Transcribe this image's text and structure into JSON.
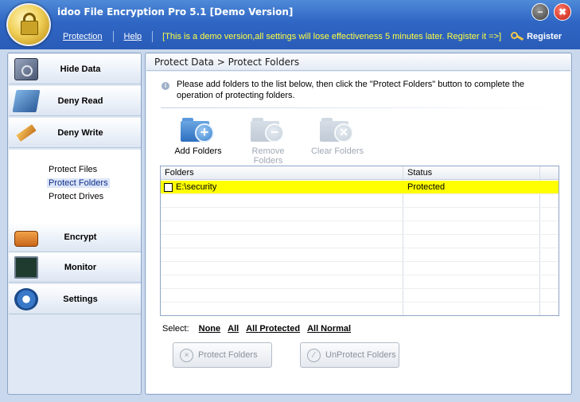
{
  "window": {
    "title": "idoo File Encryption Pro 5.1 [Demo Version]",
    "minimize_glyph": "−",
    "close_glyph": "✖"
  },
  "menu": {
    "items": [
      {
        "label": "Protection"
      },
      {
        "label": "Help"
      }
    ],
    "demo_notice": "[This is a demo version,all settings will lose effectiveness 5 minutes later. Register it =>]",
    "register_label": "Register"
  },
  "sidebar": {
    "nav": [
      {
        "label": "Hide Data",
        "icon": "safe-icon"
      },
      {
        "label": "Deny Read",
        "icon": "book-icon"
      },
      {
        "label": "Deny Write",
        "icon": "pen-icon"
      },
      {
        "label": "Encrypt",
        "icon": "lock-icon"
      },
      {
        "label": "Monitor",
        "icon": "monitor-icon"
      },
      {
        "label": "Settings",
        "icon": "gear-icon"
      }
    ],
    "sub_items": [
      {
        "label": "Protect Files",
        "active": false
      },
      {
        "label": "Protect Folders",
        "active": true
      },
      {
        "label": "Protect Drives",
        "active": false
      }
    ]
  },
  "main": {
    "breadcrumb": "Protect Data > Protect Folders",
    "info_text": "Please add folders to the list below, then click the \"Protect Folders\" button to complete the operation of protecting folders.",
    "info_glyph": "i",
    "toolbar": [
      {
        "label": "Add Folders",
        "enabled": true,
        "glyph": "+"
      },
      {
        "label": "Remove Folders",
        "enabled": false,
        "glyph": "−"
      },
      {
        "label": "Clear Folders",
        "enabled": false,
        "glyph": "×"
      }
    ],
    "table": {
      "columns": [
        "Folders",
        "Status"
      ],
      "rows": [
        {
          "folder": "E:\\security",
          "status": "Protected",
          "checked": false,
          "highlighted": true
        }
      ]
    },
    "select": {
      "label": "Select:",
      "options": [
        "None",
        "All",
        "All Protected",
        "All Normal"
      ]
    },
    "actions": [
      {
        "label": "Protect Folders",
        "glyph": "×"
      },
      {
        "label": "UnProtect Folders",
        "glyph": "∕"
      }
    ]
  },
  "colors": {
    "titlebar": "#2f66c4",
    "demo_notice": "#ffff40",
    "row_highlight": "#ffff00"
  }
}
